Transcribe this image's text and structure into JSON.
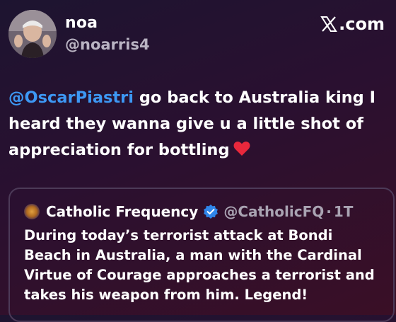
{
  "author": {
    "display_name": "noa",
    "handle": "@noarris4",
    "avatar_icon": "profile-photo"
  },
  "brand": {
    "label": ".com",
    "logo_icon": "x-logo-icon"
  },
  "tweet": {
    "mention": "@OscarPiastri",
    "text_line1": " go back to Australia king I",
    "text_line2": "heard they wanna give u a little shot of",
    "text_line3": "appreciation for bottling",
    "emoji": "red-heart-icon"
  },
  "quoted_tweet": {
    "display_name": "Catholic Frequency",
    "handle": "@CatholicFQ",
    "separator": "·",
    "time": "1T",
    "verified_icon": "verified-badge-icon",
    "line1": "During today’s terrorist attack at Bondi",
    "line2": "Beach in Australia, a man with the Cardinal",
    "line3": "Virtue of Courage approaches a terrorist and",
    "line4": "takes his weapon from him.  Legend!"
  },
  "colors": {
    "mention": "#3d98f4",
    "verified": "#2f86ea",
    "heart": "#e8283c",
    "secondary_text": "#b9b3c2"
  }
}
